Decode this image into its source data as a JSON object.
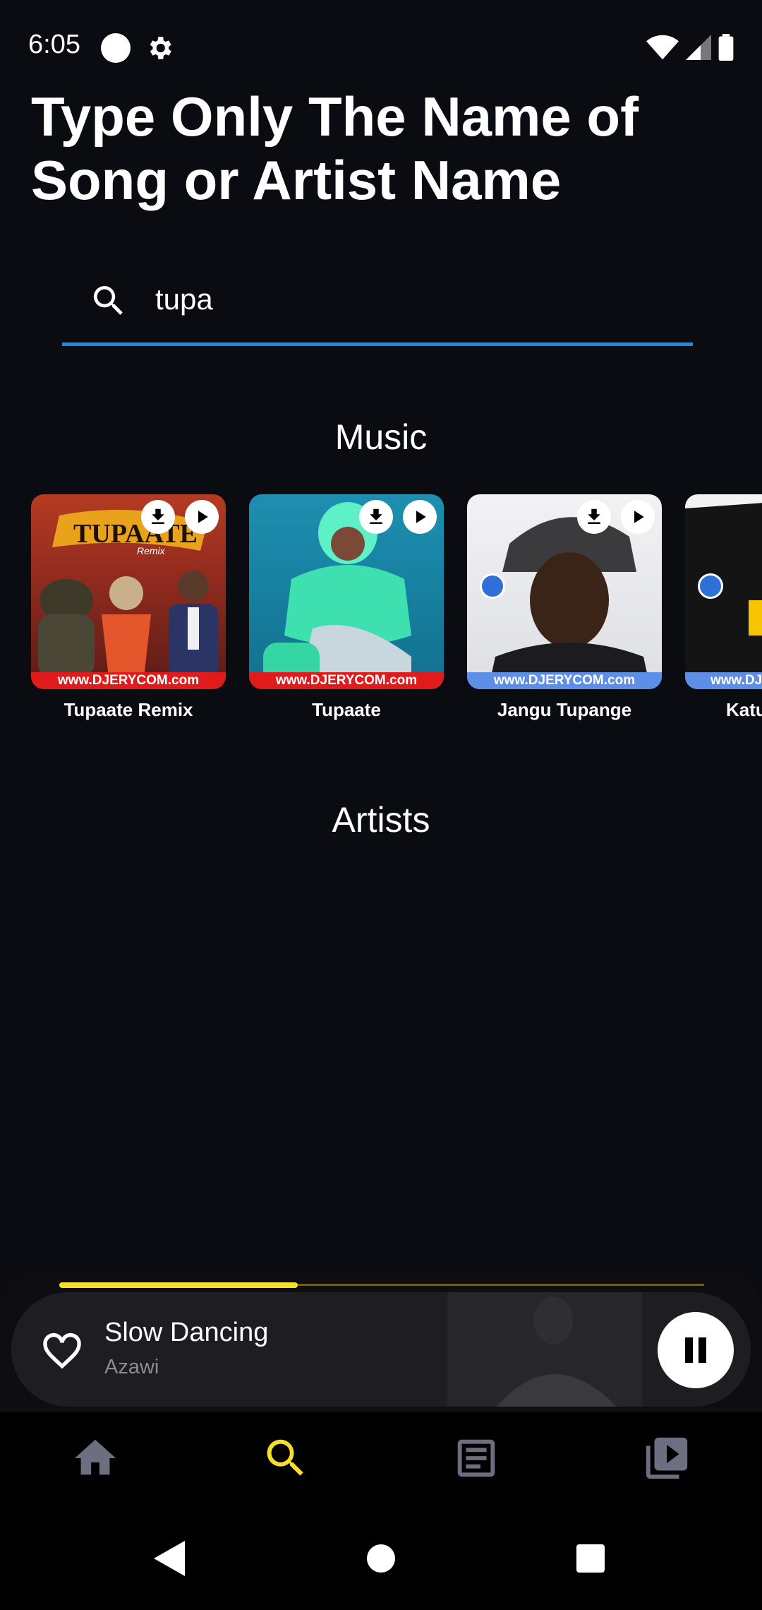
{
  "status_bar": {
    "time": "6:05"
  },
  "header": {
    "title": "Type Only The Name of Song or Artist Name"
  },
  "search": {
    "value": "tupa"
  },
  "sections": {
    "music_title": "Music",
    "artists_title": "Artists"
  },
  "music": [
    {
      "title": "Tupaate Remix",
      "banner": "www.DJERYCOM.com",
      "art_text": "TUPAATE",
      "art_sub": "Remix"
    },
    {
      "title": "Tupaate",
      "banner": "www.DJERYCOM.com"
    },
    {
      "title": "Jangu Tupange",
      "banner": "www.DJERYCOM.com"
    },
    {
      "title": "Katu",
      "banner": "www.DJ"
    }
  ],
  "player": {
    "song_title": "Slow Dancing",
    "artist": "Azawi",
    "progress": 0.37
  },
  "colors": {
    "accent_blue": "#1e88e5",
    "accent_yellow": "#f6de2a",
    "background": "#0b0c12"
  },
  "nav": {
    "items": [
      "home-icon",
      "search-icon",
      "article-icon",
      "video-library-icon"
    ],
    "active": "search-icon"
  }
}
